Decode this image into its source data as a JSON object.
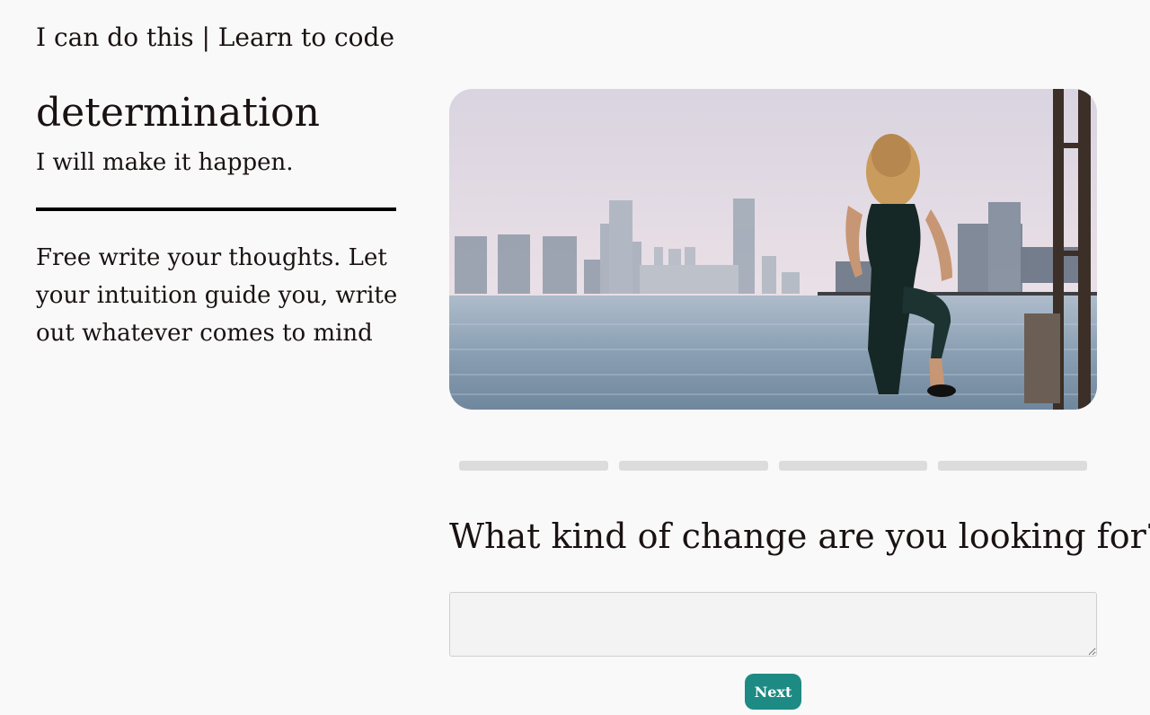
{
  "header": {
    "title": "I can do this | Learn to code"
  },
  "sidebar": {
    "word": "determination",
    "affirmation": "I will make it happen.",
    "prompt": "Free write your thoughts. Let your intuition guide you, write out whatever comes to mind"
  },
  "main": {
    "progress": {
      "total_steps": 4
    },
    "question": "What kind of change are you looking for?",
    "answer": {
      "value": "",
      "placeholder": ""
    },
    "next_label": "Next"
  },
  "colors": {
    "background": "#f9f9f9",
    "text": "#1a1212",
    "accent": "#1d8a84",
    "progress_track": "#dcdcdc"
  }
}
